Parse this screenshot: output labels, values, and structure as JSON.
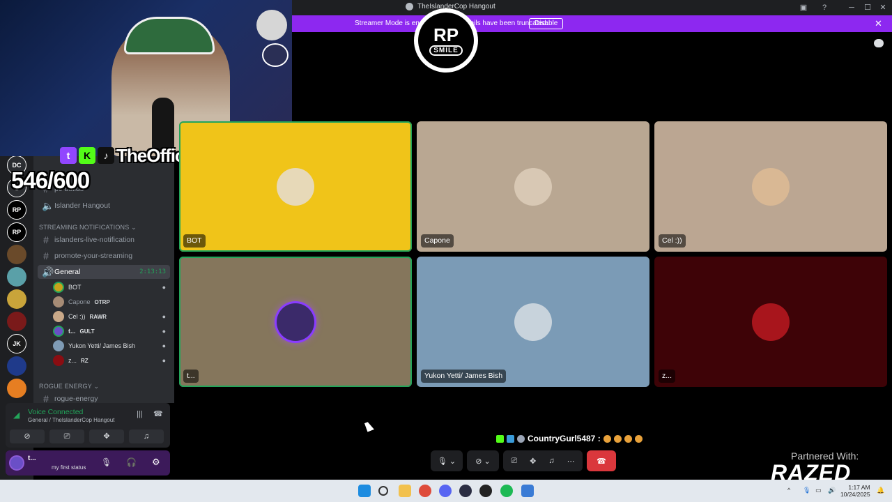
{
  "window": {
    "title": "TheIslanderCop Hangout",
    "minimize_glyph": "─",
    "maximize_glyph": "☐",
    "close_glyph": "✕"
  },
  "banner": {
    "message": "Streamer Mode is enabled. Some details have been truncated.",
    "disable_label": "Disable"
  },
  "overlay": {
    "streamer_name": "TheOfficialJONAS",
    "counter": "546/600",
    "logo_top": "RP",
    "logo_bottom": "SMILE",
    "partner_text": "Partnered With:",
    "partner_brand": "RAZED"
  },
  "sidebar": {
    "channels": [
      {
        "label": "pc-builds",
        "type": "text"
      },
      {
        "label": "Islander Hangout",
        "type": "voice"
      }
    ],
    "category_streaming": "STREAMING NOTIFICATIONS",
    "streaming_channels": [
      {
        "label": "islanders-live-notification",
        "type": "text"
      },
      {
        "label": "promote-your-streaming",
        "type": "text"
      }
    ],
    "active_voice": {
      "label": "General",
      "timer": "2:13:13"
    },
    "voice_users": [
      {
        "name": "BOT",
        "tag": "",
        "color": "#c7a21c"
      },
      {
        "name": "Capone",
        "tag": "OTRP",
        "color": "#a68b75"
      },
      {
        "name": "Cel :))",
        "tag": "RAWR",
        "color": "#c9a888"
      },
      {
        "name": "t...",
        "tag": "GULT",
        "color": "#6a4fc7"
      },
      {
        "name": "Yukon Yetti/ James Bish",
        "tag": "",
        "color": "#7f9bb5"
      },
      {
        "name": "z...",
        "tag": "RZ",
        "color": "#8a0d12"
      }
    ],
    "category_rogue": "ROGUE ENERGY",
    "rogue_channel": "rogue-energy"
  },
  "voice_panel": {
    "status": "Voice Connected",
    "location": "General / TheIslanderCop Hangout"
  },
  "user_panel": {
    "username": "t...",
    "status": "my first status"
  },
  "tiles": [
    {
      "label": "BOT",
      "bg": "#f0c419",
      "avatar": "#e7d9b8"
    },
    {
      "label": "Capone",
      "bg": "#b9a792",
      "avatar": "#d8c8b4"
    },
    {
      "label": "Cel :))",
      "bg": "#bba692",
      "avatar": "#d9b894"
    },
    {
      "label": "t...",
      "bg": "#85765c",
      "avatar": "#3b2a6a"
    },
    {
      "label": "Yukon Yetti/ James Bish",
      "bg": "#7b9bb6",
      "avatar": "#c8d3dc"
    },
    {
      "label": "z...",
      "bg": "#3e0307",
      "avatar": "#a8151c"
    }
  ],
  "chat_overlay": {
    "username": "CountryGurl5487 :"
  },
  "taskbar": {
    "time": "1:17 AM",
    "date": "10/24/2025"
  }
}
